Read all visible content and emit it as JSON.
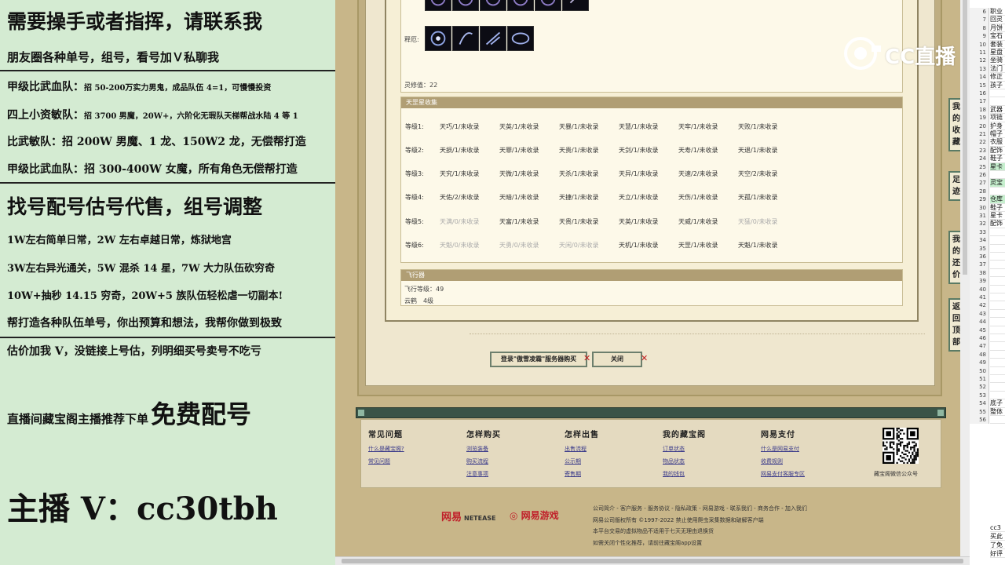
{
  "promo": {
    "line1": "需要操手或者指挥，请联系我",
    "line2": "朋友圈各种单号，组号，看号加Ｖ私聊我",
    "line3_bold": "甲级比武血队：",
    "line3_rest": "招 50-200万实力男鬼，成品队伍 4=1，可慢慢投资",
    "line4_bold": "四上小资敏队：",
    "line4_rest": "招 3700 男魔，20W+，六阶化无瑕队天梯帮战水陆 4 等 1",
    "line5": "比武敏队：招 200W 男魔、1 龙、150W2 龙，无偿帮打造",
    "line6": "甲级比武血队：招 300-400W 女魔，所有角色无偿帮打造",
    "line7": "找号配号估号代售，组号调整",
    "line8": "1W左右简单日常，2W 左右卓越日常，炼狱地宫",
    "line9": "3W左右异光通关，5W 混杀 14 星，7W 大力队伍砍穷奇",
    "line10": "10W+抽秒 14.15 穷奇，20W+5 族队伍轻松虐一切副本!",
    "line11": "帮打造各种队伍单号，你出预算和想法，我帮你做到极致",
    "line12": "估价加我 V，没链接上号估，列明细买号卖号不吃亏",
    "line13_small": "直播间藏宝阁主播推荐下单",
    "line13_big": "免费配号",
    "line14": "主播 V：cc30tbh"
  },
  "detail": {
    "spirit_label": "释厄:",
    "spirit_value_label": "灵修值：22",
    "collection_title": "天罡星收集",
    "levels": [
      {
        "label": "等级1:",
        "items": [
          {
            "text": "天巧/1/未收录",
            "dim": false
          },
          {
            "text": "天英/1/未收录",
            "dim": false
          },
          {
            "text": "天暴/1/未收录",
            "dim": false
          },
          {
            "text": "天慧/1/未收录",
            "dim": false
          },
          {
            "text": "天牢/1/未收录",
            "dim": false
          },
          {
            "text": "天败/1/未收录",
            "dim": false
          }
        ]
      },
      {
        "label": "等级2:",
        "items": [
          {
            "text": "天损/1/未收录",
            "dim": false
          },
          {
            "text": "天罪/1/未收录",
            "dim": false
          },
          {
            "text": "天贵/1/未收录",
            "dim": false
          },
          {
            "text": "天剑/1/未收录",
            "dim": false
          },
          {
            "text": "天寿/1/未收录",
            "dim": false
          },
          {
            "text": "天退/1/未收录",
            "dim": false
          }
        ]
      },
      {
        "label": "等级3:",
        "items": [
          {
            "text": "天究/1/未收录",
            "dim": false
          },
          {
            "text": "天微/1/未收录",
            "dim": false
          },
          {
            "text": "天杀/1/未收录",
            "dim": false
          },
          {
            "text": "天异/1/未收录",
            "dim": false
          },
          {
            "text": "天速/2/未收录",
            "dim": false
          },
          {
            "text": "天空/2/未收录",
            "dim": false
          }
        ]
      },
      {
        "label": "等级4:",
        "items": [
          {
            "text": "天佑/2/未收录",
            "dim": false
          },
          {
            "text": "天暗/1/未收录",
            "dim": false
          },
          {
            "text": "天捷/1/未收录",
            "dim": false
          },
          {
            "text": "天立/1/未收录",
            "dim": false
          },
          {
            "text": "天伤/1/未收录",
            "dim": false
          },
          {
            "text": "天孤/1/未收录",
            "dim": false
          }
        ]
      },
      {
        "label": "等级5:",
        "items": [
          {
            "text": "天满/0/未收录",
            "dim": true
          },
          {
            "text": "天富/1/未收录",
            "dim": false
          },
          {
            "text": "天贵/1/未收录",
            "dim": false
          },
          {
            "text": "天英/1/未收录",
            "dim": false
          },
          {
            "text": "天威/1/未收录",
            "dim": false
          },
          {
            "text": "天猛/0/未收录",
            "dim": true
          }
        ]
      },
      {
        "label": "等级6:",
        "items": [
          {
            "text": "天魁/0/未收录",
            "dim": true
          },
          {
            "text": "天勇/0/未收录",
            "dim": true
          },
          {
            "text": "天闲/0/未收录",
            "dim": true
          },
          {
            "text": "天机/1/未收录",
            "dim": false
          },
          {
            "text": "天罡/1/未收录",
            "dim": false
          },
          {
            "text": "天魁/1/未收录",
            "dim": false
          }
        ]
      }
    ],
    "flight_title": "飞行器",
    "flight_level": "飞行等级：49",
    "flight_cloud": "云鹤　4级"
  },
  "buttons": {
    "login_buy": "登录\"傲雪凌霜\"服务器购买",
    "close": "关闭"
  },
  "footer": {
    "cols": [
      {
        "title": "常见问题",
        "links": [
          "什么是藏宝阁?",
          "常见问题"
        ]
      },
      {
        "title": "怎样购买",
        "links": [
          "浏览装备",
          "购买流程",
          "注意事项"
        ]
      },
      {
        "title": "怎样出售",
        "links": [
          "出售流程",
          "公示期",
          "寄售期"
        ]
      },
      {
        "title": "我的藏宝阁",
        "links": [
          "订单状态",
          "物品状态",
          "我的钱包"
        ]
      },
      {
        "title": "网易支付",
        "links": [
          "什么是网易支付",
          "收费规则",
          "网易支付客服专区"
        ]
      }
    ],
    "qr_caption": "藏宝阁微信公众号",
    "brand_netease": "网易",
    "brand_netease_en": "NETEASE",
    "brand_game": "网易游戏",
    "legal": [
      "公司简介 - 客户服务 - 服务协议 - 隐私政策 - 网易游戏 - 联系我们 - 商务合作 - 加入我们",
      "网易公司版权所有 ©1997-2022  禁止使用爬虫采集数据和破解客户端",
      "本平台交易的虚拟物品不适用于七天无理由退换货",
      "如需关闭个性化推荐，请前往藏宝阁app设置"
    ]
  },
  "side_nav": [
    "我的收藏",
    "足迹",
    "我的还价",
    "返回顶部"
  ],
  "watermark": "CC直播",
  "excel": {
    "rows": [
      "6",
      "7",
      "8",
      "9",
      "10",
      "11",
      "12",
      "13",
      "14",
      "15",
      "16",
      "17",
      "18",
      "19",
      "20",
      "21",
      "22",
      "23",
      "24",
      "25",
      "26",
      "27",
      "28",
      "29",
      "30",
      "31",
      "32",
      "33",
      "34",
      "35",
      "36",
      "37",
      "38",
      "39",
      "40",
      "41",
      "42",
      "43",
      "44",
      "45",
      "46",
      "47",
      "48",
      "49",
      "50",
      "51",
      "52",
      "53",
      "54",
      "55",
      "56"
    ],
    "cells": {
      "6": "职业",
      "7": "回灵",
      "8": "月饼",
      "9": "宝石",
      "10": "套装",
      "11": "星盘",
      "12": "坐骑",
      "13": "法门",
      "14": "修正",
      "15": "孩子",
      "18": "武器",
      "19": "项链",
      "20": "护身",
      "21": "帽子",
      "22": "衣服",
      "23": "配饰",
      "24": "鞋子",
      "25": "星卡",
      "27": "灵宝",
      "29": "仓库",
      "30": "鞋子",
      "31": "星卡",
      "32": "配饰",
      "54": "底子",
      "55": "整体"
    },
    "tail_cells": [
      "cc3",
      "买此",
      "了免",
      "好评"
    ]
  }
}
